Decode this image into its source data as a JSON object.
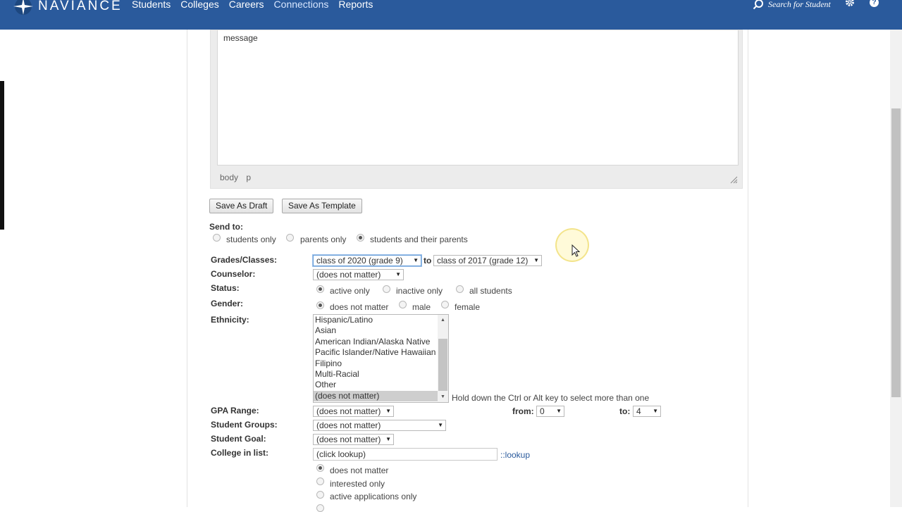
{
  "nav": {
    "brand": "NAVIANCE",
    "items": [
      "Students",
      "Colleges",
      "Careers",
      "Connections",
      "Reports"
    ],
    "search_label": "Search for Student"
  },
  "editor": {
    "message": "message",
    "path": [
      "body",
      "p"
    ]
  },
  "buttons": {
    "save_draft": "Save As Draft",
    "save_template": "Save As Template"
  },
  "send_to": {
    "label": "Send to:",
    "options": [
      "students only",
      "parents only",
      "students and their parents"
    ],
    "selected": 2
  },
  "grades": {
    "label": "Grades/Classes:",
    "from": "class of 2020 (grade 9)",
    "to_word": "to",
    "to": "class of 2017 (grade 12)"
  },
  "counselor": {
    "label": "Counselor:",
    "value": "(does not matter)"
  },
  "status": {
    "label": "Status:",
    "options": [
      "active only",
      "inactive only",
      "all students"
    ],
    "selected": 0
  },
  "gender": {
    "label": "Gender:",
    "options": [
      "does not matter",
      "male",
      "female"
    ],
    "selected": 0
  },
  "ethnicity": {
    "label": "Ethnicity:",
    "options": [
      "Hispanic/Latino",
      "Asian",
      "American Indian/Alaska Native",
      "Pacific Islander/Native Hawaiian",
      "Filipino",
      "Multi-Racial",
      "Other",
      "(does not matter)"
    ],
    "selected": 7,
    "hint": "Hold down the Ctrl or Alt key to select more than one"
  },
  "gpa": {
    "label": "GPA Range:",
    "value": "(does not matter)",
    "from_label": "from:",
    "from_value": "0",
    "to_label": "to:",
    "to_value": "4"
  },
  "groups": {
    "label": "Student Groups:",
    "value": "(does not matter)"
  },
  "goal": {
    "label": "Student Goal:",
    "value": "(does not matter)"
  },
  "college": {
    "label": "College in list:",
    "input_value": "(click lookup)",
    "lookup_link": "::lookup",
    "options": [
      "does not matter",
      "interested only",
      "active applications only"
    ],
    "selected": 0
  }
}
